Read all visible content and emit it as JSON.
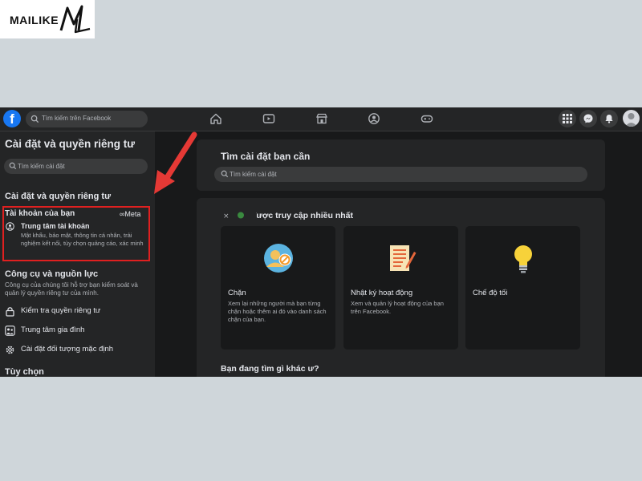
{
  "watermark": {
    "text": "MAILIKE",
    "mark_letters": "ML"
  },
  "topbar": {
    "search_placeholder": "Tìm kiếm trên Facebook",
    "logo_letter": "f",
    "nav_icons": [
      "home-icon",
      "watch-icon",
      "marketplace-icon",
      "groups-icon",
      "gaming-icon"
    ],
    "right_icons": [
      "menu-grid-icon",
      "messenger-icon",
      "notifications-icon"
    ]
  },
  "sidebar": {
    "title": "Cài đặt và quyền riêng tư",
    "search_placeholder": "Tìm kiếm cài đặt",
    "section1_title": "Cài đặt và quyền riêng tư",
    "account": {
      "title": "Tài khoản của bạn",
      "meta_label": "Meta",
      "center_name": "Trung tâm tài khoản",
      "center_desc": "Mật khẩu, bảo mật, thông tin cá nhân, trải nghiệm kết nối, tùy chọn quảng cáo, xác minh"
    },
    "tools": {
      "title": "Công cụ và nguồn lực",
      "desc": "Công cụ của chúng tôi hỗ trợ bạn kiểm soát và quản lý quyền riêng tư của mình.",
      "items": [
        {
          "label": "Kiểm tra quyền riêng tư",
          "icon": "lock-icon"
        },
        {
          "label": "Trung tâm gia đình",
          "icon": "family-icon"
        },
        {
          "label": "Cài đặt đối tượng mặc định",
          "icon": "gear-icon"
        }
      ]
    },
    "options_title": "Tùy chọn"
  },
  "main": {
    "search_card_title": "Tìm cài đặt bạn cần",
    "search_placeholder": "Tìm kiếm cài đặt",
    "most_visited_title": "Cài đặt được truy cập nhiều nhất",
    "tiles": [
      {
        "name": "Chặn",
        "desc": "Xem lại những người mà bạn từng chặn hoặc thêm ai đó vào danh sách chặn của bạn.",
        "icon": "block-icon"
      },
      {
        "name": "Nhật ký hoạt động",
        "desc": "Xem và quản lý hoạt động của bạn trên Facebook.",
        "icon": "activity-log-icon"
      },
      {
        "name": "Chế độ tối",
        "desc": "",
        "icon": "lightbulb-icon"
      }
    ],
    "bottom_title": "Bạn đang tìm gì khác ư?"
  },
  "colors": {
    "highlight_box": "#e02020",
    "arrow": "#e53935",
    "brand": "#1877f2",
    "background": "#18191a"
  }
}
